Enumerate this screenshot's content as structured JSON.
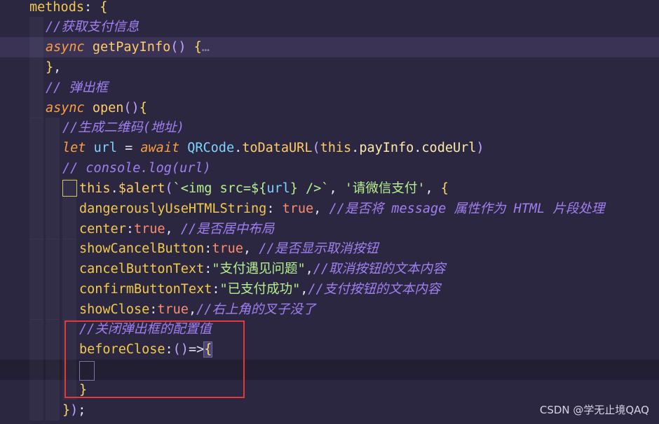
{
  "lines": [
    {
      "tokens": [
        {
          "c": "t-key",
          "t": "methods"
        },
        {
          "c": "t-punc",
          "t": ": "
        },
        {
          "c": "t-brace",
          "t": "{"
        }
      ]
    },
    {
      "tokens": [
        {
          "c": "t-cmt",
          "t": "//获取支付信息"
        }
      ]
    },
    {
      "tokens": [
        {
          "c": "t-kw",
          "t": "async"
        },
        {
          "c": "t-punc",
          "t": " "
        },
        {
          "c": "t-fn",
          "t": "getPayInfo"
        },
        {
          "c": "t-paren",
          "t": "()"
        },
        {
          "c": "t-punc",
          "t": " "
        },
        {
          "c": "t-brace",
          "t": "{"
        },
        {
          "c": "t-dots",
          "t": "…"
        }
      ]
    },
    {
      "tokens": [
        {
          "c": "t-brace",
          "t": "}"
        },
        {
          "c": "t-punc",
          "t": ","
        }
      ]
    },
    {
      "tokens": [
        {
          "c": "t-cmt",
          "t": "// 弹出框"
        }
      ]
    },
    {
      "tokens": [
        {
          "c": "t-kw",
          "t": "async"
        },
        {
          "c": "t-punc",
          "t": " "
        },
        {
          "c": "t-fn",
          "t": "open"
        },
        {
          "c": "t-paren",
          "t": "()"
        },
        {
          "c": "t-brace",
          "t": "{"
        }
      ]
    },
    {
      "tokens": [
        {
          "c": "t-cmt",
          "t": "//生成二维码(地址)"
        }
      ]
    },
    {
      "tokens": [
        {
          "c": "t-kw",
          "t": "let"
        },
        {
          "c": "t-punc",
          "t": " "
        },
        {
          "c": "t-var",
          "t": "url"
        },
        {
          "c": "t-punc",
          "t": " = "
        },
        {
          "c": "t-kw",
          "t": "await"
        },
        {
          "c": "t-punc",
          "t": " "
        },
        {
          "c": "t-var",
          "t": "QRCode"
        },
        {
          "c": "t-punc",
          "t": "."
        },
        {
          "c": "t-fn",
          "t": "toDataURL"
        },
        {
          "c": "t-paren",
          "t": "("
        },
        {
          "c": "t-this",
          "t": "this"
        },
        {
          "c": "t-punc",
          "t": "."
        },
        {
          "c": "t-prop",
          "t": "payInfo"
        },
        {
          "c": "t-punc",
          "t": "."
        },
        {
          "c": "t-prop",
          "t": "codeUrl"
        },
        {
          "c": "t-paren",
          "t": ")"
        }
      ]
    },
    {
      "tokens": [
        {
          "c": "t-cmt",
          "t": "// console.log(url)"
        }
      ]
    },
    {
      "tokens": [
        {
          "c": "t-this",
          "t": "this"
        },
        {
          "c": "t-punc",
          "t": "."
        },
        {
          "c": "t-fn",
          "t": "$alert"
        },
        {
          "c": "t-paren",
          "t": "("
        },
        {
          "c": "t-str",
          "t": "`<img src=${"
        },
        {
          "c": "t-var",
          "t": "url"
        },
        {
          "c": "t-str",
          "t": "} />`"
        },
        {
          "c": "t-punc",
          "t": ", "
        },
        {
          "c": "t-str",
          "t": "'请微信支付'"
        },
        {
          "c": "t-punc",
          "t": ", "
        },
        {
          "c": "t-brace",
          "t": "{"
        }
      ]
    },
    {
      "tokens": [
        {
          "c": "t-key",
          "t": "dangerouslyUseHTMLString"
        },
        {
          "c": "t-punc",
          "t": ": "
        },
        {
          "c": "t-bool",
          "t": "true"
        },
        {
          "c": "t-punc",
          "t": ", "
        },
        {
          "c": "t-cmt",
          "t": "//是否将 message 属性作为 HTML 片段处理"
        }
      ]
    },
    {
      "tokens": [
        {
          "c": "t-key",
          "t": "center"
        },
        {
          "c": "t-punc",
          "t": ":"
        },
        {
          "c": "t-bool",
          "t": "true"
        },
        {
          "c": "t-punc",
          "t": ", "
        },
        {
          "c": "t-cmt",
          "t": "//是否居中布局"
        }
      ]
    },
    {
      "tokens": [
        {
          "c": "t-key",
          "t": "showCancelButton"
        },
        {
          "c": "t-punc",
          "t": ":"
        },
        {
          "c": "t-bool",
          "t": "true"
        },
        {
          "c": "t-punc",
          "t": ", "
        },
        {
          "c": "t-cmt",
          "t": "//是否显示取消按钮"
        }
      ]
    },
    {
      "tokens": [
        {
          "c": "t-key",
          "t": "cancelButtonText"
        },
        {
          "c": "t-punc",
          "t": ":"
        },
        {
          "c": "t-str",
          "t": "\"支付遇见问题\""
        },
        {
          "c": "t-punc",
          "t": ","
        },
        {
          "c": "t-cmt",
          "t": "//取消按钮的文本内容"
        }
      ]
    },
    {
      "tokens": [
        {
          "c": "t-key",
          "t": "confirmButtonText"
        },
        {
          "c": "t-punc",
          "t": ":"
        },
        {
          "c": "t-str",
          "t": "\"已支付成功\""
        },
        {
          "c": "t-punc",
          "t": ","
        },
        {
          "c": "t-cmt",
          "t": "//支付按钮的文本内容"
        }
      ]
    },
    {
      "tokens": [
        {
          "c": "t-key",
          "t": "showClose"
        },
        {
          "c": "t-punc",
          "t": ":"
        },
        {
          "c": "t-bool",
          "t": "true"
        },
        {
          "c": "t-punc",
          "t": ","
        },
        {
          "c": "t-cmt",
          "t": "//右上角的叉子没了"
        }
      ]
    },
    {
      "tokens": [
        {
          "c": "t-cmt",
          "t": "//关闭弹出框的配置值"
        }
      ]
    },
    {
      "tokens": [
        {
          "c": "t-key",
          "t": "beforeClose"
        },
        {
          "c": "t-punc",
          "t": ":"
        },
        {
          "c": "t-paren",
          "t": "()"
        },
        {
          "c": "t-punc",
          "t": "=>"
        },
        {
          "c": "t-brace",
          "t": "{"
        }
      ]
    },
    {
      "tokens": []
    },
    {
      "tokens": [
        {
          "c": "t-brace",
          "t": "}"
        }
      ]
    },
    {
      "tokens": [
        {
          "c": "t-brace",
          "t": "}"
        },
        {
          "c": "t-paren",
          "t": ")"
        },
        {
          "c": "t-punc",
          "t": ";"
        }
      ]
    }
  ],
  "watermark": "CSDN @学无止境QAQ"
}
